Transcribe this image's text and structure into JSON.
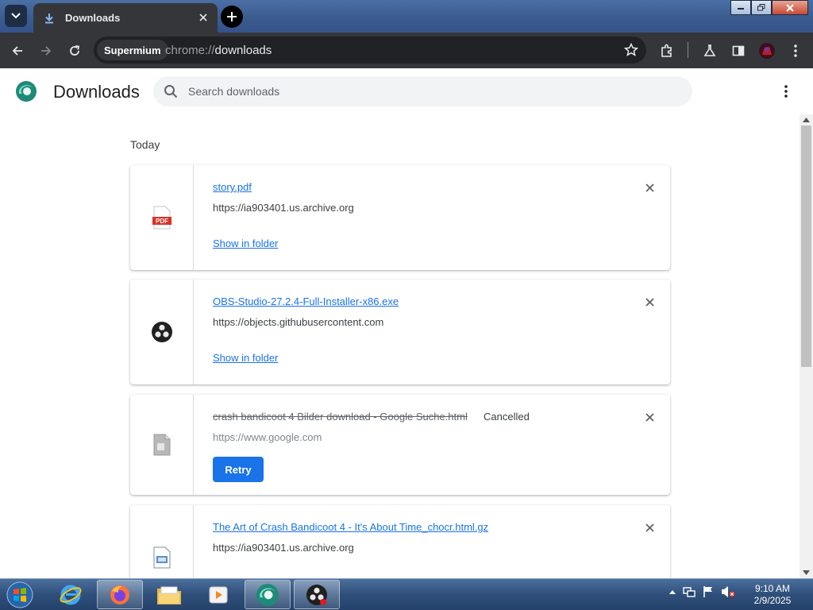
{
  "browser": {
    "tab_title": "Downloads",
    "profile_chip": "Supermium",
    "url_scheme": "chrome://",
    "url_host": "downloads"
  },
  "page": {
    "title": "Downloads",
    "search_placeholder": "Search downloads",
    "section_label": "Today"
  },
  "downloads": [
    {
      "filename": "story.pdf",
      "source": "https://ia903401.us.archive.org",
      "action": "Show in folder",
      "status": "",
      "icon": "pdf-file-icon"
    },
    {
      "filename": "OBS-Studio-27.2.4-Full-Installer-x86.exe",
      "source": "https://objects.githubusercontent.com",
      "action": "Show in folder",
      "status": "",
      "icon": "obs-studio-icon"
    },
    {
      "filename": "crash bandicoot 4 Bilder download - Google Suche.html",
      "source": "https://www.google.com",
      "action": "Retry",
      "status": "Cancelled",
      "icon": "generic-file-icon"
    },
    {
      "filename": "The Art of Crash Bandicoot 4 - It's About Time_chocr.html.gz",
      "source": "https://ia903401.us.archive.org",
      "action": "",
      "status": "",
      "icon": "archive-file-icon"
    }
  ],
  "taskbar": {
    "time": "9:10 AM",
    "date": "2/9/2025",
    "apps": [
      "internet-explorer-icon",
      "firefox-icon",
      "file-explorer-icon",
      "media-player-icon",
      "supermium-icon",
      "obs-studio-icon"
    ]
  },
  "colors": {
    "link": "#1a73e8",
    "retry_button": "#1a73e8",
    "toolbar": "#35363a"
  }
}
